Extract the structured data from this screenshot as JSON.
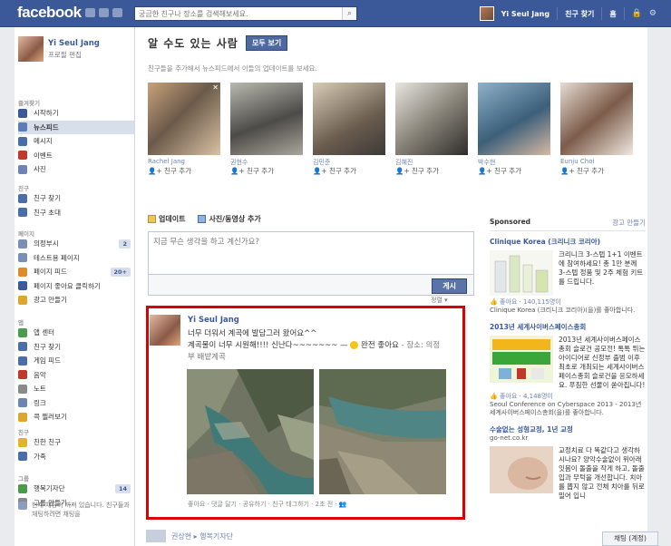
{
  "topbar": {
    "logo": "facebook",
    "search_placeholder": "궁금한 친구나 장소를 검색해보세요.",
    "user_name": "Yi Seul Jang",
    "find_friends": "친구 찾기",
    "home": "홈"
  },
  "sidebar": {
    "profile_name": "Yi Seul Jang",
    "profile_edit": "프로필 편집",
    "sections": [
      {
        "head": "즐겨찾기",
        "items": [
          {
            "label": "시작하기",
            "icon": "flag-icon",
            "color": "#3b5998"
          },
          {
            "label": "뉴스피드",
            "icon": "newsfeed-icon",
            "color": "#5b7bb9",
            "selected": true
          },
          {
            "label": "메시지",
            "icon": "messages-icon",
            "color": "#4a6ea9"
          },
          {
            "label": "이벤트",
            "icon": "calendar-icon",
            "color": "#c0392b"
          },
          {
            "label": "사진",
            "icon": "photos-icon",
            "color": "#6d84b4"
          }
        ]
      },
      {
        "head": "친구",
        "items": [
          {
            "label": "친구 찾기",
            "icon": "friends-icon",
            "color": "#4a6ea9"
          },
          {
            "label": "친구 초대",
            "icon": "invite-icon",
            "color": "#4a6ea9"
          }
        ]
      },
      {
        "head": "페이지",
        "items": [
          {
            "label": "의정부시",
            "icon": "page-icon",
            "color": "#7a8fb5",
            "count": "2"
          },
          {
            "label": "테스트용 페이지",
            "icon": "page-icon",
            "color": "#7a8fb5"
          },
          {
            "label": "페이지 피드",
            "icon": "pagefeed-icon",
            "color": "#e08a2c",
            "count": "20+"
          },
          {
            "label": "페이지 좋아요 클릭하기",
            "icon": "like-pages-icon",
            "color": "#3b5998"
          },
          {
            "label": "광고 만들기",
            "icon": "ad-icon",
            "color": "#e0a52c"
          }
        ]
      },
      {
        "head": "앱",
        "items": [
          {
            "label": "앱 센터",
            "icon": "app-center-icon",
            "color": "#4a9b4a"
          },
          {
            "label": "친구 찾기",
            "icon": "friends-icon",
            "color": "#4a6ea9"
          },
          {
            "label": "게임 피드",
            "icon": "games-icon",
            "color": "#4a6ea9"
          },
          {
            "label": "음악",
            "icon": "music-icon",
            "color": "#c0392b"
          },
          {
            "label": "노트",
            "icon": "notes-icon",
            "color": "#8a8a8a"
          },
          {
            "label": "링크",
            "icon": "links-icon",
            "color": "#6d84b4"
          },
          {
            "label": "콕 찔러보기",
            "icon": "poke-icon",
            "color": "#e0a52c"
          }
        ]
      },
      {
        "head": "친구",
        "items": [
          {
            "label": "친한 친구",
            "icon": "close-friends-icon",
            "color": "#e0b52c"
          },
          {
            "label": "가족",
            "icon": "family-icon",
            "color": "#4a6ea9"
          }
        ]
      },
      {
        "head": "그룹",
        "items": [
          {
            "label": "행복기자단",
            "icon": "group-icon",
            "color": "#4a9b4a",
            "count": "14"
          },
          {
            "label": "그룹 만들기...",
            "icon": "create-group-icon",
            "color": "#8a8a8a"
          }
        ]
      }
    ],
    "chat_note": "현재 채팅이 꺼져 있습니다. 친구들과 채팅하려면 채팅을"
  },
  "pymk": {
    "title": "알 수도 있는 사람",
    "see_all": "모두 보기",
    "subtitle": "친구들을 추가해서 뉴스피드에서 이들의 업데이트를 보세요.",
    "people": [
      {
        "name": "Rachel Jang",
        "add": "친구 추가"
      },
      {
        "name": "권현수",
        "add": "친구 추가"
      },
      {
        "name": "김민준",
        "add": "친구 추가"
      },
      {
        "name": "김혜진",
        "add": "친구 추가"
      },
      {
        "name": "박수현",
        "add": "친구 추가"
      },
      {
        "name": "Eunju Choi",
        "add": "친구 추가"
      }
    ]
  },
  "composer": {
    "tab_update": "업데이트",
    "tab_photo": "사진/동영상 추가",
    "placeholder": "지금 무슨 생각을 하고 계신가요?",
    "post_button": "게시",
    "sort_label": "정렬 ▾"
  },
  "story": {
    "author": "Yi Seul Jang",
    "text_line1": "너무 더워서 계곡에 발담그러 왔어요^^",
    "text_line2": "계곡물이 너무 시원해!!!! 신난다~~~~~~~ —",
    "feeling": "완전 좋아요",
    "location": "- 장소: 의정부 배밭계곡",
    "footer": "좋아요 · 댓글 달기 · 공유하기 · 친구 태그하기 · 2초 전 · ",
    "next_author": "권상현 ▸ 행복기자단"
  },
  "right": {
    "sponsored": "Sponsored",
    "make_ad": "광고 만들기",
    "ads": [
      {
        "title": "Clinique Korea (크리니크 코리아)",
        "text": "크리니크 3-스텝 1+1 이벤트에 참여하세요! 총 1만 분께 3-스텝 정품 및 2주 체험 키트를 드립니다.",
        "like": "좋아요 · 140,115명이",
        "sub": "Clinique Korea (크리니크 코리아)(을)를 좋아합니다."
      },
      {
        "title": "2013년 세계사이버스페이스총회",
        "text": "2013년 세계사이버스페이스총회 슬로건 공모전! 톡톡 튀는 아이디어로 신정부 출범 이후 최초로 개최되는 세계사이버스페이스총회 슬로건을 응모하세요. 푸짐한 선물이 쏟아집니다!",
        "like": "좋아요 · 4,148명이",
        "sub": "Seoul Conference on Cyberspace 2013 - 2013년 세계사이버스페이스총회(을)를 좋아합니다."
      },
      {
        "title": "수술없는 성형교정, 1년 교정",
        "domain": "go-net.co.kr",
        "text": "교정치료 다 똑같다고 생각하시나요? 양악수술없이 위아래 잇몸이 돌출을 작게 하고, 돌출입과 무턱을 개선합니다. 치아를 뽑지 않고 전체 치아를 뒤로 밀어 입니"
      }
    ],
    "chat": "채팅 (계정)"
  },
  "colors": {
    "brand": "#3b5998",
    "highlight": "#dd0000"
  }
}
